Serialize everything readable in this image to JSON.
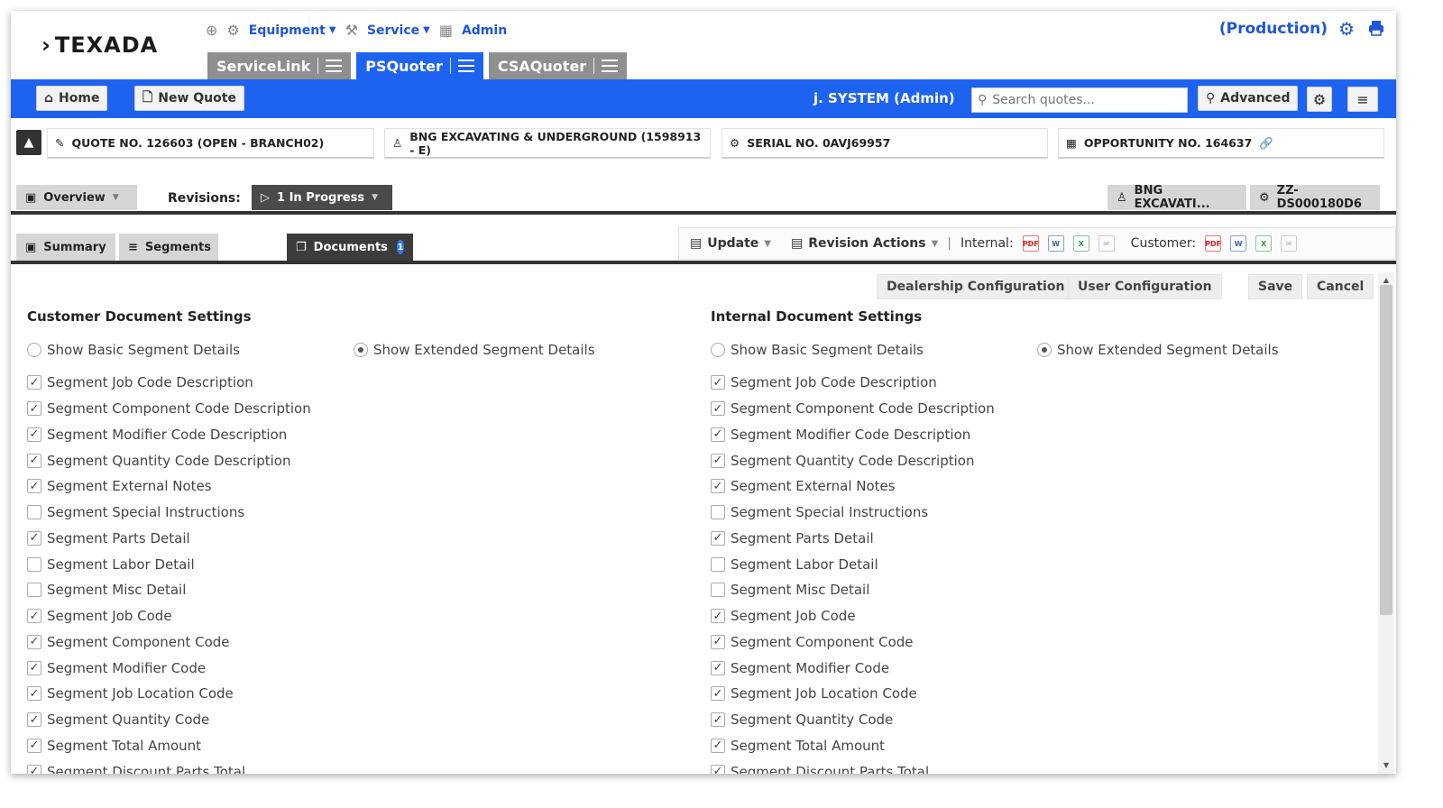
{
  "header": {
    "logo": "TEXADA",
    "nav": [
      {
        "label": "Equipment"
      },
      {
        "label": "Service"
      },
      {
        "label": "Admin"
      }
    ],
    "environment": "(Production)"
  },
  "app_tabs": [
    {
      "label": "ServiceLink"
    },
    {
      "label": "PSQuoter"
    },
    {
      "label": "CSAQuoter"
    }
  ],
  "toolbar": {
    "home_label": "Home",
    "new_quote_label": "New Quote",
    "user": "j. SYSTEM (Admin)",
    "search_placeholder": "Search quotes...",
    "advanced_label": "Advanced"
  },
  "info": {
    "quote": "QUOTE NO. 126603 (OPEN - BRANCH02)",
    "customer": "BNG EXCAVATING & UNDERGROUND (1598913 - E)",
    "serial": "SERIAL NO. 0AVJ69957",
    "opportunity": "OPPORTUNITY NO. 164637"
  },
  "revision_row": {
    "overview_label": "Overview",
    "revisions_label": "Revisions:",
    "revision_value": "1 In Progress",
    "customer_short": "BNG EXCAVATI...",
    "serial_short": "ZZ-DS000180D6"
  },
  "subtabs": {
    "summary": "Summary",
    "segments": "Segments",
    "documents": "Documents",
    "documents_badge": "1"
  },
  "actions": {
    "update_label": "Update",
    "revision_actions_label": "Revision Actions",
    "internal_label": "Internal:",
    "customer_label": "Customer:"
  },
  "config_buttons": {
    "dealership": "Dealership Configuration",
    "user": "User Configuration",
    "save": "Save",
    "cancel": "Cancel"
  },
  "customer_settings": {
    "title": "Customer Document Settings",
    "basic_label": "Show Basic Segment Details",
    "extended_label": "Show Extended Segment Details",
    "selected": "extended",
    "options": [
      {
        "label": "Segment Job Code Description",
        "checked": true
      },
      {
        "label": "Segment Component Code Description",
        "checked": true
      },
      {
        "label": "Segment Modifier Code Description",
        "checked": true
      },
      {
        "label": "Segment Quantity Code Description",
        "checked": true
      },
      {
        "label": "Segment External Notes",
        "checked": true
      },
      {
        "label": "Segment Special Instructions",
        "checked": false
      },
      {
        "label": "Segment Parts Detail",
        "checked": true
      },
      {
        "label": "Segment Labor Detail",
        "checked": false
      },
      {
        "label": "Segment Misc Detail",
        "checked": false
      },
      {
        "label": "Segment Job Code",
        "checked": true
      },
      {
        "label": "Segment Component Code",
        "checked": true
      },
      {
        "label": "Segment Modifier Code",
        "checked": true
      },
      {
        "label": "Segment Job Location Code",
        "checked": true
      },
      {
        "label": "Segment Quantity Code",
        "checked": true
      },
      {
        "label": "Segment Total Amount",
        "checked": true
      },
      {
        "label": "Segment Discount Parts Total",
        "checked": true
      }
    ]
  },
  "internal_settings": {
    "title": "Internal Document Settings",
    "basic_label": "Show Basic Segment Details",
    "extended_label": "Show Extended Segment Details",
    "selected": "extended",
    "options": [
      {
        "label": "Segment Job Code Description",
        "checked": true
      },
      {
        "label": "Segment Component Code Description",
        "checked": true
      },
      {
        "label": "Segment Modifier Code Description",
        "checked": true
      },
      {
        "label": "Segment Quantity Code Description",
        "checked": true
      },
      {
        "label": "Segment External Notes",
        "checked": true
      },
      {
        "label": "Segment Special Instructions",
        "checked": false
      },
      {
        "label": "Segment Parts Detail",
        "checked": true
      },
      {
        "label": "Segment Labor Detail",
        "checked": false
      },
      {
        "label": "Segment Misc Detail",
        "checked": false
      },
      {
        "label": "Segment Job Code",
        "checked": true
      },
      {
        "label": "Segment Component Code",
        "checked": true
      },
      {
        "label": "Segment Modifier Code",
        "checked": true
      },
      {
        "label": "Segment Job Location Code",
        "checked": true
      },
      {
        "label": "Segment Quantity Code",
        "checked": true
      },
      {
        "label": "Segment Total Amount",
        "checked": true
      },
      {
        "label": "Segment Discount Parts Total",
        "checked": true
      }
    ]
  }
}
